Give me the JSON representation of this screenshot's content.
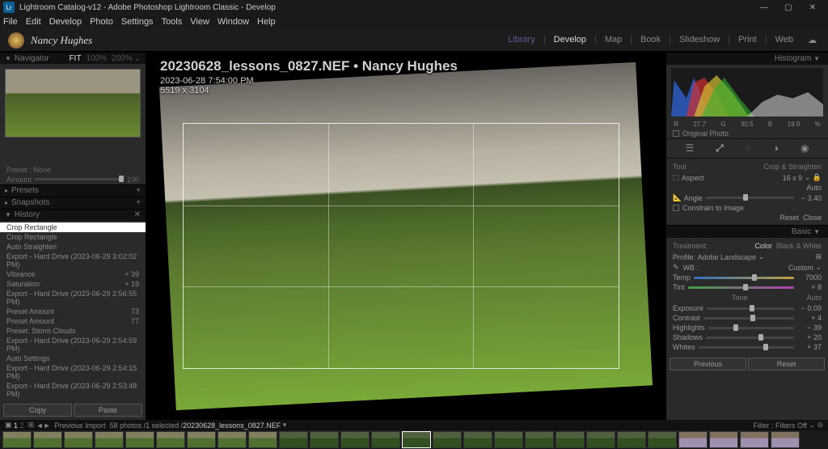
{
  "titlebar": {
    "appicon": "Lr",
    "title": "Lightroom Catalog-v12 - Adobe Photoshop Lightroom Classic - Develop"
  },
  "menubar": [
    "File",
    "Edit",
    "Develop",
    "Photo",
    "Settings",
    "Tools",
    "View",
    "Window",
    "Help"
  ],
  "user": "Nancy Hughes",
  "modules": [
    "Library",
    "Develop",
    "Map",
    "Book",
    "Slideshow",
    "Print",
    "Web"
  ],
  "active_module": "Develop",
  "navigator": {
    "title": "Navigator",
    "fit": "FIT",
    "z1": "100%",
    "z2": "200%"
  },
  "preset_info": {
    "preset_label": "Preset :",
    "preset_value": "None",
    "amount_label": "Amount",
    "amount_value": "100"
  },
  "panels": {
    "presets": "Presets",
    "snapshots": "Snapshots",
    "history": "History"
  },
  "history": [
    {
      "label": "Crop Rectangle",
      "val": ""
    },
    {
      "label": "Crop Rectangle",
      "val": ""
    },
    {
      "label": "Auto Straighten",
      "val": ""
    },
    {
      "label": "Export - Hard Drive (2023-06-29 3:02:02 PM)",
      "val": ""
    },
    {
      "label": "Vibrance",
      "val": "+ 39"
    },
    {
      "label": "Saturation",
      "val": "+ 19"
    },
    {
      "label": "Export - Hard Drive (2023-06-29 2:56:55 PM)",
      "val": ""
    },
    {
      "label": "Preset Amount",
      "val": "73"
    },
    {
      "label": "Preset Amount",
      "val": "77"
    },
    {
      "label": "Preset: Storm Clouds",
      "val": ""
    },
    {
      "label": "Export - Hard Drive (2023-06-29 2:54:59 PM)",
      "val": ""
    },
    {
      "label": "Auto Settings",
      "val": ""
    },
    {
      "label": "Export - Hard Drive (2023-06-29 2:54:15 PM)",
      "val": ""
    },
    {
      "label": "Export - Hard Drive (2023-06-29 2:53:48 PM)",
      "val": ""
    }
  ],
  "copy_paste": {
    "copy": "Copy",
    "paste": "Paste"
  },
  "overlay": {
    "filename": "20230628_lessons_0827.NEF  •  Nancy Hughes",
    "datetime": "2023-06-28 7:54:00 PM",
    "dims": "5519 x 3104"
  },
  "histogram": {
    "title": "Histogram",
    "r": "27.7",
    "g": "30.5",
    "b": "19.9",
    "pct": "%",
    "original": "Original Photo"
  },
  "crop_tool": {
    "title": "Tool",
    "name": "Crop & Straighten",
    "aspect_label": "Aspect",
    "aspect_value": "16 x 9",
    "angle_label": "Angle",
    "auto": "Auto",
    "angle_value": "− 3.40",
    "constrain": "Constrain to Image",
    "reset": "Reset",
    "close": "Close"
  },
  "basic": {
    "title": "Basic",
    "treatment": "Treatment:",
    "color": "Color",
    "bw": "Black & White",
    "profile_label": "Profile:",
    "profile_value": "Adobe Landscape",
    "wb_label": "WB :",
    "wb_value": "Custom",
    "temp_label": "Temp",
    "temp_value": "7000",
    "tint_label": "Tint",
    "tint_value": "+ 8",
    "tone": "Tone",
    "auto": "Auto",
    "exposure_label": "Exposure",
    "exposure_value": "− 0.09",
    "contrast_label": "Contrast",
    "contrast_value": "+ 4",
    "highlights_label": "Highlights",
    "highlights_value": "− 39",
    "shadows_label": "Shadows",
    "shadows_value": "+ 20",
    "whites_label": "Whites",
    "whites_value": "+ 37",
    "previous": "Previous",
    "reset": "Reset"
  },
  "filmstrip": {
    "prev": "Previous Import",
    "count": "58 photos /1 selected /",
    "file": "20230628_lessons_0827.NEF",
    "filter": "Filter :",
    "filters_off": "Filters Off"
  }
}
